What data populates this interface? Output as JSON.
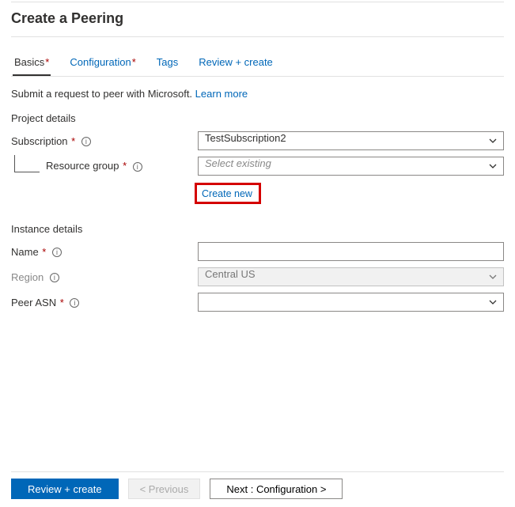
{
  "header": {
    "title": "Create a Peering"
  },
  "tabs": {
    "basics": "Basics",
    "configuration": "Configuration",
    "tags": "Tags",
    "review": "Review + create"
  },
  "description": {
    "text": "Submit a request to peer with Microsoft.",
    "learn_more_label": "Learn more"
  },
  "sections": {
    "project_details": "Project details",
    "instance_details": "Instance details"
  },
  "fields": {
    "subscription": {
      "label": "Subscription",
      "value": "TestSubscription2"
    },
    "resource_group": {
      "label": "Resource group",
      "placeholder": "Select existing",
      "create_new_label": "Create new"
    },
    "name": {
      "label": "Name",
      "value": ""
    },
    "region": {
      "label": "Region",
      "value": "Central US"
    },
    "peer_asn": {
      "label": "Peer ASN",
      "value": ""
    }
  },
  "footer": {
    "review_create": "Review + create",
    "previous": "< Previous",
    "next": "Next : Configuration >"
  }
}
